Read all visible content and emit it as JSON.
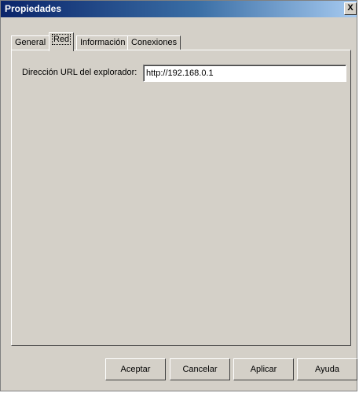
{
  "window": {
    "title": "Propiedades",
    "close_glyph": "X"
  },
  "tabs": [
    {
      "label": "General",
      "active": false
    },
    {
      "label": "Red",
      "active": true
    },
    {
      "label": "Información",
      "active": false
    },
    {
      "label": "Conexiones",
      "active": false
    }
  ],
  "panel": {
    "url_label": "Dirección URL del explorador:",
    "url_value": "http://192.168.0.1"
  },
  "buttons": {
    "ok": "Aceptar",
    "cancel": "Cancelar",
    "apply": "Aplicar",
    "help": "Ayuda"
  },
  "icons": {
    "close": "close-icon"
  }
}
